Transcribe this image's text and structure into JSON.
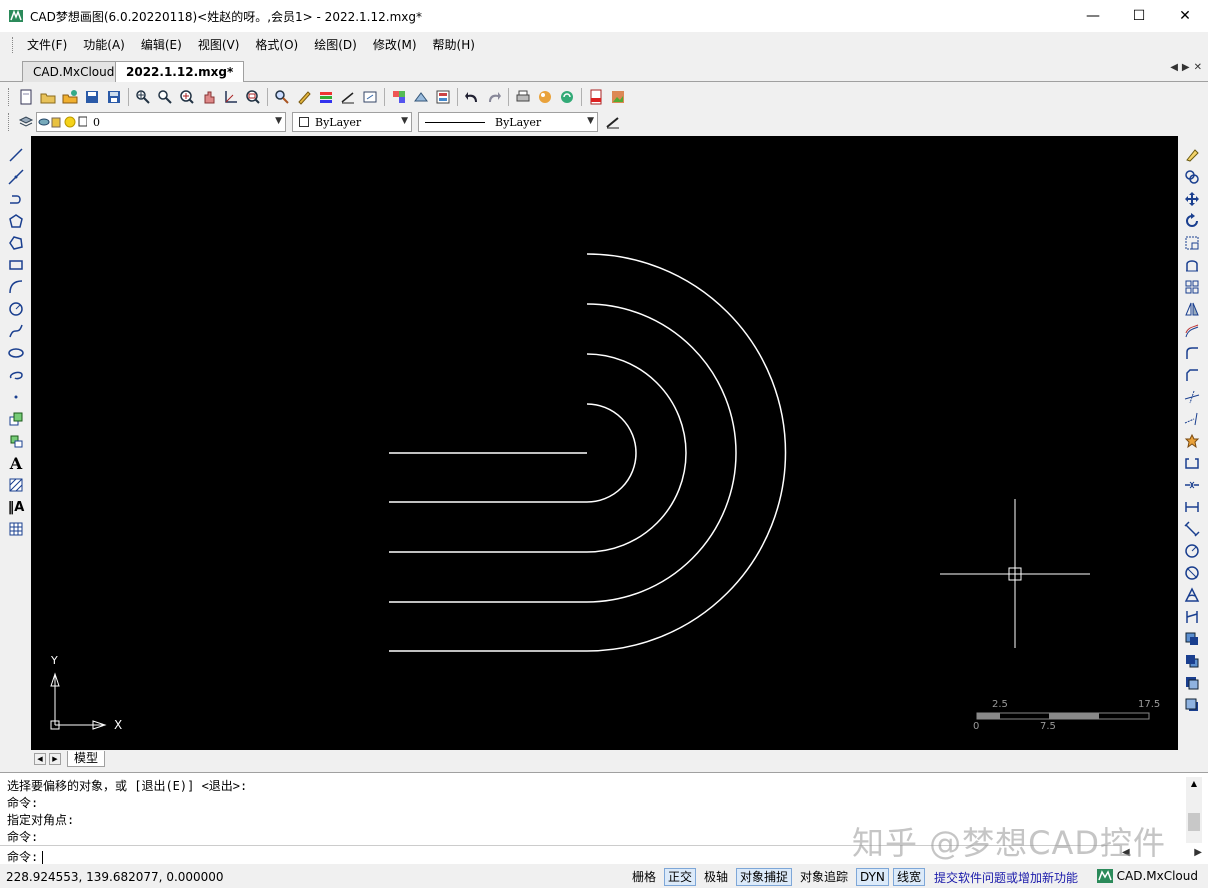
{
  "window": {
    "title": "CAD梦想画图(6.0.20220118)<姓赵的呀。,会员1> - 2022.1.12.mxg*",
    "minimize": "—",
    "maximize": "☐",
    "close": "✕"
  },
  "menu": [
    "文件(F)",
    "功能(A)",
    "编辑(E)",
    "视图(V)",
    "格式(O)",
    "绘图(D)",
    "修改(M)",
    "帮助(H)"
  ],
  "tabs": [
    {
      "label": "CAD.MxCloud",
      "active": false
    },
    {
      "label": "2022.1.12.mxg*",
      "active": true
    }
  ],
  "tab_nav": {
    "prev": "◀",
    "next": "▶",
    "close": "✕"
  },
  "properties": {
    "layer": "0",
    "color": "ByLayer",
    "linetype": "ByLayer"
  },
  "canvas": {
    "background": "#000000",
    "stroke": "#ffffff",
    "ucs_x": "X",
    "ucs_y": "Y",
    "scale_labels_top": [
      "2.5",
      "17.5"
    ],
    "scale_labels_bottom": [
      "0",
      "7.5"
    ]
  },
  "layout": {
    "tab": "模型"
  },
  "command": {
    "lines": [
      "选择要偏移的对象，或 [退出(E)] <退出>:",
      "命令:",
      " 指定对角点:",
      "命令:"
    ],
    "prompt": "命令:"
  },
  "status": {
    "coords": "228.924553,  139.682077,  0.000000",
    "toggles": [
      {
        "label": "栅格",
        "on": false
      },
      {
        "label": "正交",
        "on": true
      },
      {
        "label": "极轴",
        "on": false
      },
      {
        "label": "对象捕捉",
        "on": true
      },
      {
        "label": "对象追踪",
        "on": false
      },
      {
        "label": "DYN",
        "on": true
      },
      {
        "label": "线宽",
        "on": true
      }
    ],
    "feedback_link": "提交软件问题或增加新功能",
    "brand": "CAD.MxCloud"
  },
  "watermark": "知乎 @梦想CAD控件"
}
